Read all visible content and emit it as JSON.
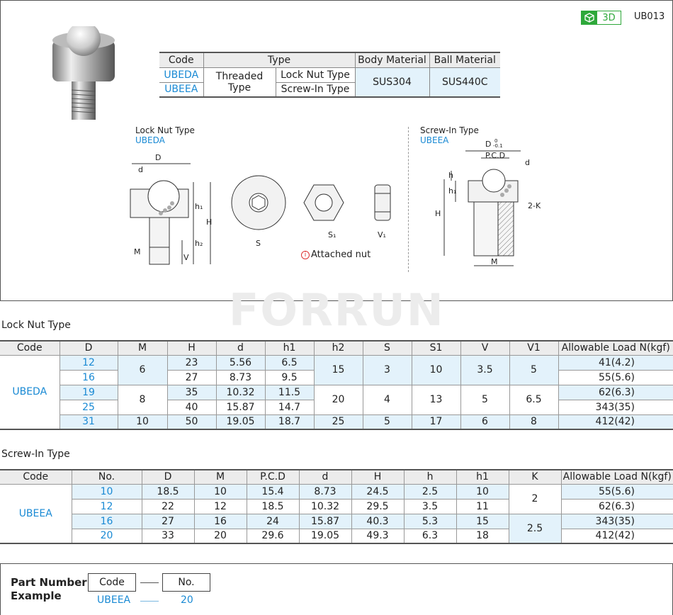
{
  "header": {
    "btn_3d_label": "3D",
    "page_code": "UB013"
  },
  "type_table": {
    "headers": [
      "Code",
      "Type",
      "Body Material",
      "Ball Material"
    ],
    "codes": [
      "UBEDA",
      "UBEEA"
    ],
    "type_main": "Threaded Type",
    "subtypes": [
      "Lock Nut Type",
      "Screw-In Type"
    ],
    "body_material": "SUS304",
    "ball_material": "SUS440C"
  },
  "drawings": {
    "lock_nut_title": "Lock Nut Type",
    "lock_nut_code": "UBEDA",
    "screw_in_title": "Screw-In Type",
    "screw_in_code": "UBEEA",
    "attached_nut": "Attached nut",
    "dims_lock": [
      "D",
      "d",
      "h1",
      "H",
      "h2",
      "M",
      "V",
      "S",
      "S1",
      "V1"
    ],
    "dims_screw": [
      "D",
      "0",
      "-0.1",
      "P.C.D",
      "d",
      "h",
      "h1",
      "H",
      "2-K",
      "M"
    ]
  },
  "watermark": "FORRUN",
  "lock_nut_section": {
    "title": "Lock Nut Type",
    "headers": [
      "Code",
      "D",
      "M",
      "H",
      "d",
      "h1",
      "h2",
      "S",
      "S1",
      "V",
      "V1",
      "Allowable Load N(kgf)"
    ],
    "code": "UBEDA",
    "D": [
      "12",
      "16",
      "19",
      "25",
      "31"
    ],
    "M": [
      "6",
      "8",
      "10"
    ],
    "H": [
      "23",
      "27",
      "35",
      "40",
      "50"
    ],
    "d": [
      "5.56",
      "8.73",
      "10.32",
      "15.87",
      "19.05"
    ],
    "h1": [
      "6.5",
      "9.5",
      "11.5",
      "14.7",
      "18.7"
    ],
    "h2": [
      "15",
      "20",
      "25"
    ],
    "S": [
      "3",
      "4",
      "5"
    ],
    "S1": [
      "10",
      "13",
      "17"
    ],
    "V": [
      "3.5",
      "5",
      "6"
    ],
    "V1": [
      "5",
      "6.5",
      "8"
    ],
    "load": [
      "41(4.2)",
      "55(5.6)",
      "62(6.3)",
      "343(35)",
      "412(42)"
    ]
  },
  "screw_in_section": {
    "title": "Screw-In Type",
    "headers": [
      "Code",
      "No.",
      "D",
      "M",
      "P.C.D",
      "d",
      "H",
      "h",
      "h1",
      "K",
      "Allowable Load N(kgf)"
    ],
    "code": "UBEEA",
    "No": [
      "10",
      "12",
      "16",
      "20"
    ],
    "D": [
      "18.5",
      "22",
      "27",
      "33"
    ],
    "M": [
      "10",
      "12",
      "16",
      "20"
    ],
    "PCD": [
      "15.4",
      "18.5",
      "24",
      "29.6"
    ],
    "d": [
      "8.73",
      "10.32",
      "15.87",
      "19.05"
    ],
    "H": [
      "24.5",
      "29.5",
      "40.3",
      "49.3"
    ],
    "h": [
      "2.5",
      "3.5",
      "5.3",
      "6.3"
    ],
    "h1": [
      "10",
      "11",
      "15",
      "18"
    ],
    "K": [
      "2",
      "2.5"
    ],
    "load": [
      "55(5.6)",
      "62(6.3)",
      "343(35)",
      "412(42)"
    ]
  },
  "part_number_example": {
    "title_line1": "Part Number",
    "title_line2": "Example",
    "code_label": "Code",
    "no_label": "No.",
    "code_value": "UBEEA",
    "no_value": "20"
  }
}
